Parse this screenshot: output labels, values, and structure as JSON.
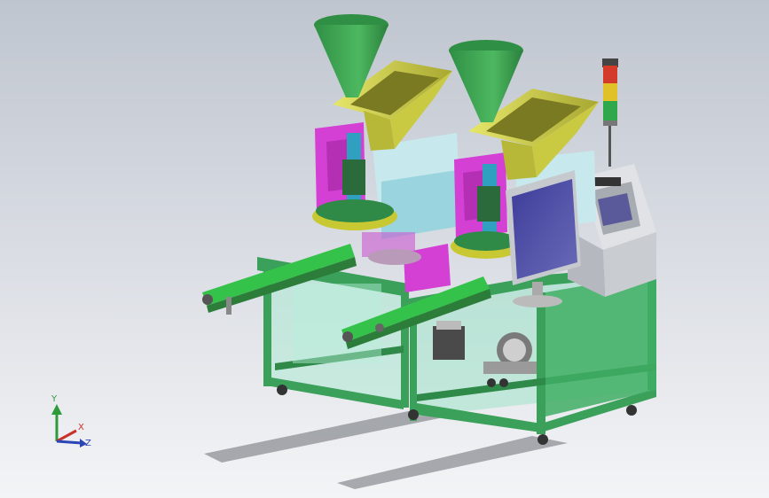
{
  "viewport": {
    "background_top": "#bfc5cf",
    "background_bottom": "#f3f4f6"
  },
  "model": {
    "frame_color": "#3aa05a",
    "frame_glass": "#9fe3c8",
    "conveyor_color": "#35c24a",
    "hopper_color": "#3aa24f",
    "chute_color": "#d8d84a",
    "body_color": "#d43fd4",
    "screen_color": "#5a5aa8",
    "control_cabinet": "#cfd2d6",
    "stack_light_colors": [
      "#d43a2a",
      "#e0c228",
      "#2ea84a"
    ]
  },
  "triad": {
    "y_label": "Y",
    "x_label": "X",
    "z_label": "Z",
    "y_color": "#2e9a3a",
    "x_color": "#c8322a",
    "z_color": "#2a45b5"
  }
}
